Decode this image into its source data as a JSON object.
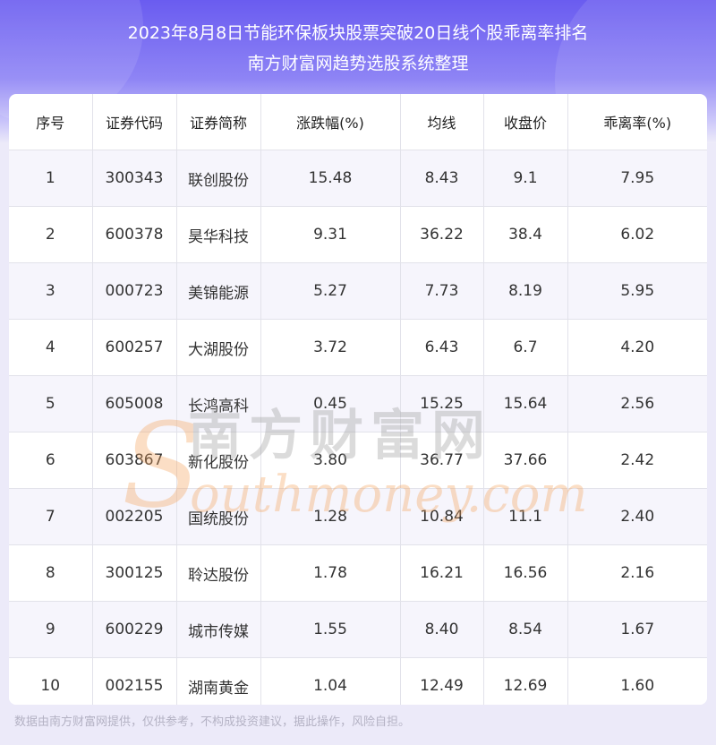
{
  "title_line1": "2023年8月8日节能环保板块股票突破20日线个股乖离率排名",
  "title_line2": "南方财富网趋势选股系统整理",
  "columns": [
    "序号",
    "证券代码",
    "证券简称",
    "涨跌幅(%)",
    "均线",
    "收盘价",
    "乖离率(%)"
  ],
  "rows": [
    [
      "1",
      "300343",
      "联创股份",
      "15.48",
      "8.43",
      "9.1",
      "7.95"
    ],
    [
      "2",
      "600378",
      "昊华科技",
      "9.31",
      "36.22",
      "38.4",
      "6.02"
    ],
    [
      "3",
      "000723",
      "美锦能源",
      "5.27",
      "7.73",
      "8.19",
      "5.95"
    ],
    [
      "4",
      "600257",
      "大湖股份",
      "3.72",
      "6.43",
      "6.7",
      "4.20"
    ],
    [
      "5",
      "605008",
      "长鸿高科",
      "0.45",
      "15.25",
      "15.64",
      "2.56"
    ],
    [
      "6",
      "603867",
      "新化股份",
      "3.80",
      "36.77",
      "37.66",
      "2.42"
    ],
    [
      "7",
      "002205",
      "国统股份",
      "1.28",
      "10.84",
      "11.1",
      "2.40"
    ],
    [
      "8",
      "300125",
      "聆达股份",
      "1.78",
      "16.21",
      "16.56",
      "2.16"
    ],
    [
      "9",
      "600229",
      "城市传媒",
      "1.55",
      "8.40",
      "8.54",
      "1.67"
    ],
    [
      "10",
      "002155",
      "湖南黄金",
      "1.04",
      "12.49",
      "12.69",
      "1.60"
    ]
  ],
  "watermark_cn": "南方财富网",
  "watermark_en": "outhmoney.com",
  "footer": "数据由南方财富网提供，仅供参考，不构成投资建议，据此操作，风险自担。",
  "colors": {
    "header_top": "#6a5cf0",
    "header_bottom": "#eceaf9",
    "watermark_orange": "#f5a35b",
    "watermark_gray": "#9a9a9a"
  }
}
